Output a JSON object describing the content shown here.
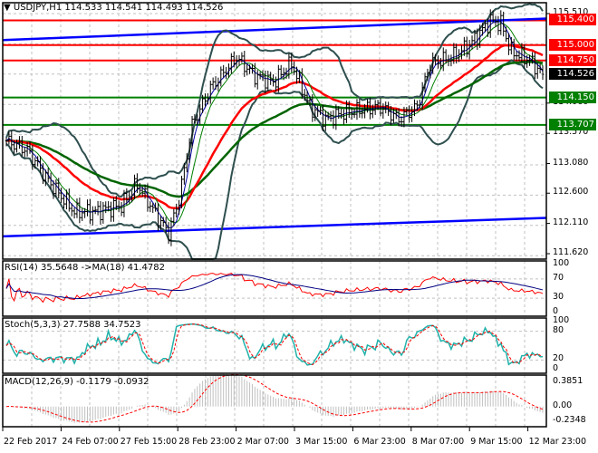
{
  "header": {
    "symbol": "USDJPY,H1",
    "ohlc": "114.533 114.541 114.493 114.526"
  },
  "price_axis": [
    "115.510",
    "114.060",
    "113.570",
    "113.080",
    "112.600",
    "112.110",
    "111.620"
  ],
  "price_tags": [
    {
      "label": "115.400",
      "color": "#ff0000"
    },
    {
      "label": "115.000",
      "color": "#ff0000"
    },
    {
      "label": "114.750",
      "color": "#ff0000"
    },
    {
      "label": "114.526",
      "color": "#000000"
    },
    {
      "label": "114.150",
      "color": "#008000"
    },
    {
      "label": "113.707",
      "color": "#008000"
    }
  ],
  "time_axis": [
    "22 Feb 2017",
    "24 Feb 07:00",
    "27 Feb 15:00",
    "28 Feb 23:00",
    "2 Mar 07:00",
    "3 Mar 15:00",
    "6 Mar 23:00",
    "8 Mar 07:00",
    "9 Mar 15:00",
    "12 Mar 23:00"
  ],
  "rsi": {
    "label": "RSI(14) 35.5648  ->MA(18) 41.4782",
    "axis": [
      "100",
      "70",
      "30",
      "0"
    ]
  },
  "stoch": {
    "label": "Stoch(5,3,3) 27.7588 34.7523",
    "axis": [
      "100",
      "80",
      "20",
      "0"
    ]
  },
  "macd": {
    "label": "MACD(12,26,9) -0.1179 -0.0932",
    "axis": [
      "0.3851",
      "0.00",
      "-0.2348"
    ]
  },
  "chart_data": {
    "type": "candlestick",
    "symbol": "USDJPY",
    "timeframe": "H1",
    "ylim": [
      111.62,
      115.51
    ],
    "close_path": [
      [
        0,
        113.45
      ],
      [
        8,
        113.3
      ],
      [
        16,
        112.8
      ],
      [
        26,
        112.3
      ],
      [
        34,
        112.3
      ],
      [
        44,
        112.4
      ],
      [
        50,
        112.75
      ],
      [
        58,
        112.2
      ],
      [
        62,
        111.95
      ],
      [
        66,
        112.5
      ],
      [
        71,
        113.7
      ],
      [
        78,
        114.3
      ],
      [
        88,
        114.8
      ],
      [
        95,
        114.5
      ],
      [
        102,
        114.4
      ],
      [
        109,
        114.7
      ],
      [
        116,
        114.0
      ],
      [
        122,
        113.8
      ],
      [
        129,
        113.9
      ],
      [
        143,
        114.0
      ],
      [
        150,
        113.8
      ],
      [
        157,
        114.0
      ],
      [
        162,
        114.7
      ],
      [
        170,
        114.8
      ],
      [
        177,
        115.0
      ],
      [
        185,
        115.4
      ],
      [
        189,
        115.35
      ],
      [
        193,
        114.9
      ],
      [
        200,
        114.75
      ],
      [
        205,
        114.526
      ]
    ],
    "levels": [
      {
        "price": 115.4,
        "color": "#ff0000"
      },
      {
        "price": 115.0,
        "color": "#ff0000"
      },
      {
        "price": 114.75,
        "color": "#ff0000"
      },
      {
        "price": 114.15,
        "color": "#008000"
      },
      {
        "price": 113.707,
        "color": "#008000"
      }
    ],
    "trendlines": [
      {
        "from": 115.08,
        "to": 115.43,
        "color": "#0000ff"
      },
      {
        "from": 111.9,
        "to": 112.2,
        "color": "#0000ff"
      }
    ],
    "colors": {
      "bars": "#000000",
      "ma_fast": "#0000a0",
      "ma_mid": "#008000",
      "ma_slow": "#ff0000",
      "ma_long": "#006400",
      "bands": "#2f4f4f",
      "rsi": "#ff0000",
      "rsi_ma": "#000080",
      "stoch_main": "#20b2aa",
      "stoch_signal": "#ff0000",
      "macd_hist": "#c0c0c0",
      "macd_signal": "#ff0000"
    }
  }
}
